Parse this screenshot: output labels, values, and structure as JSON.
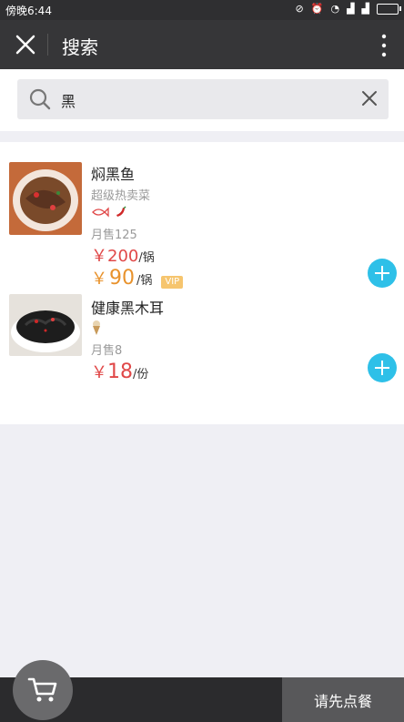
{
  "status": {
    "time": "傍晚6:44"
  },
  "nav": {
    "title": "搜索"
  },
  "search": {
    "query": "黑"
  },
  "items": [
    {
      "name": "焖黑鱼",
      "tag": "超级热卖菜",
      "sold": "月售125",
      "price_symbol": "￥",
      "price": "200",
      "price_unit": "/锅",
      "vip_symbol": "￥",
      "vip_price": "90",
      "vip_unit": "/锅",
      "vip_label": "VIP"
    },
    {
      "name": "健康黑木耳",
      "sold": "月售8",
      "price_symbol": "￥",
      "price": "18",
      "price_unit": "/份"
    }
  ],
  "cart": {
    "checkout_label": "请先点餐"
  },
  "colors": {
    "accent": "#2ec0e8",
    "price": "#e04848",
    "vip": "#e8922c"
  }
}
